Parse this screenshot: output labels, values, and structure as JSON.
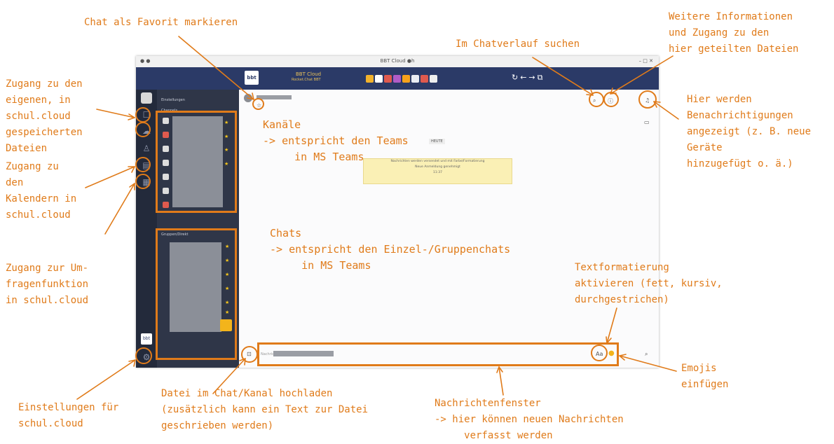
{
  "window": {
    "title": "BBT Cloud ●h",
    "controls_left": "● ●",
    "controls_right": "– □ ✕",
    "app_title": "BBT Cloud",
    "app_subtitle": "Rocket.Chat BBT"
  },
  "sidebar": {
    "header": "Einstellungen",
    "section_channels": "Channels",
    "section_chats": "Gruppen/Direkt",
    "icons": [
      "chat-icon",
      "cloud-icon",
      "user-icon",
      "calendar-icon",
      "survey-icon",
      "settings-icon"
    ]
  },
  "chat": {
    "date_badge": "HEUTE",
    "system_message": [
      "Nachrichten werden versendet und mit Farbe/Formatierung",
      "Neue Anmeldung genehmigt",
      "11:37"
    ],
    "composer_placeholder": "Nachricht an"
  },
  "annotations": {
    "favorite": "Chat als Favorit markieren",
    "search": "Im Chatverlauf suchen",
    "info": "Weitere Informationen\nund Zugang zu den\nhier geteilten Dateien",
    "notifications": "Hier werden\nBenachrichtigungen\nangezeigt (z. B. neue\nGeräte\nhinzugefügt o. ä.)",
    "files": "Zugang zu den\neigenen, in\nschul.cloud\ngespeicherten\nDateien",
    "calendar": "Zugang zu\nden\nKalendern in\nschul.cloud",
    "survey": "Zugang zur Um-\nfragenfunktion\nin schul.cloud",
    "settings": "Einstellungen für\nschul.cloud",
    "channels": "Kanäle\n-> entspricht den Teams\n     in MS Teams",
    "chats": "Chats\n-> entspricht den Einzel-/Gruppenchats\n     in MS Teams",
    "formatting": "Textformatierung\naktivieren (fett, kursiv,\ndurchgestrichen)",
    "emojis": "Emojis\neinfügen",
    "upload": "Datei im Chat/Kanal hochladen\n(zusätzlich kann ein Text zur Datei\ngeschrieben werden)",
    "message_window": "Nachrichtenfenster\n-> hier können neuen Nachrichten\n     verfasst werden"
  },
  "colors": {
    "accent": "#e07b1a",
    "header": "#2b3a67",
    "sidebar": "#2f3648",
    "rail": "#232a3b",
    "star": "#f3c41b"
  }
}
